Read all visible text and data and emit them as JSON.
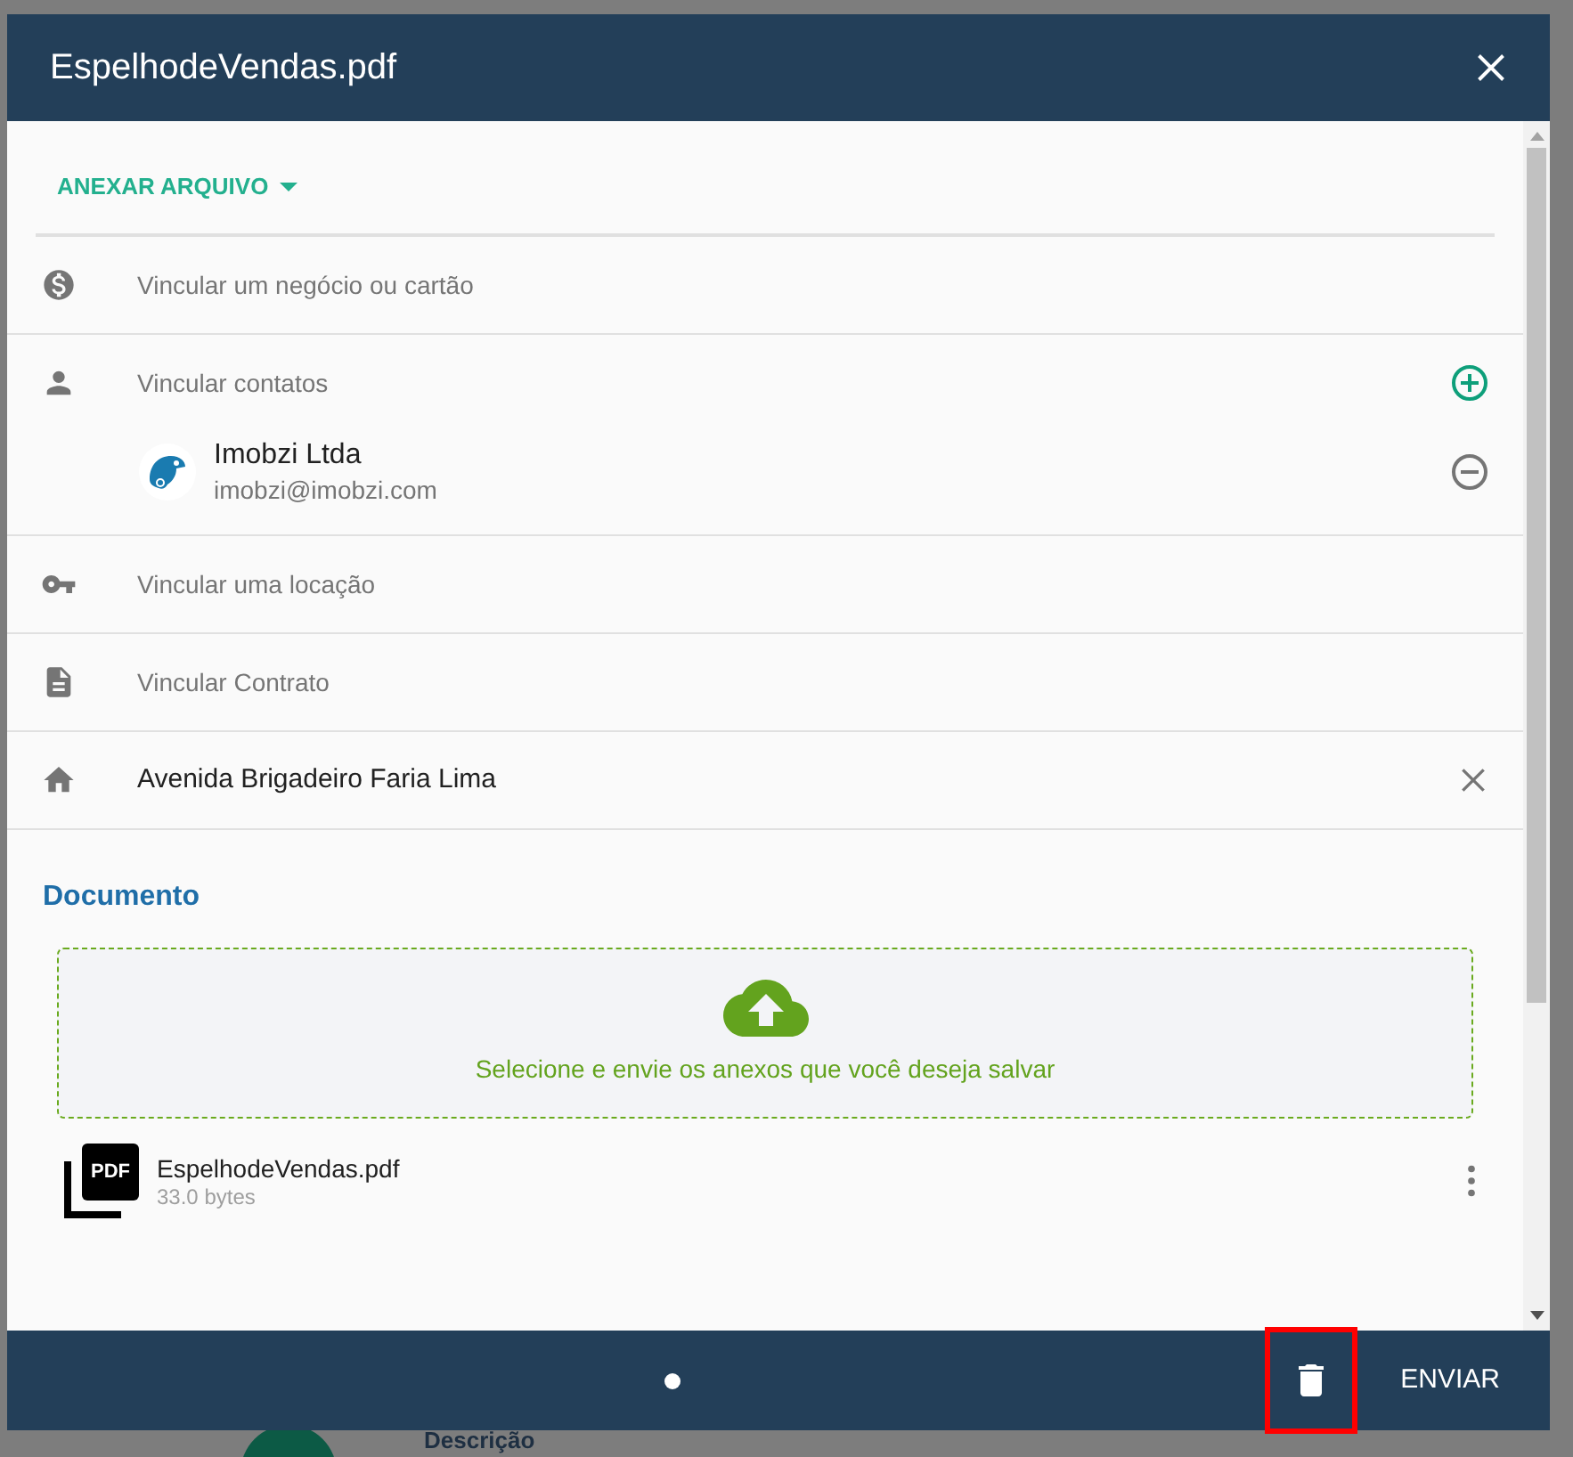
{
  "dialog": {
    "title": "EspelhodeVendas.pdf"
  },
  "attach_menu": {
    "label": "ANEXAR ARQUIVO"
  },
  "rows": [
    {
      "kind": "empty",
      "label": "Vincular um negócio ou cartão"
    },
    {
      "kind": "contacts",
      "label": "Vincular contatos",
      "contacts": [
        {
          "name": "Imobzi Ltda",
          "email": "imobzi@imobzi.com"
        }
      ]
    },
    {
      "kind": "empty",
      "label": "Vincular uma locação"
    },
    {
      "kind": "empty",
      "label": "Vincular Contrato"
    },
    {
      "kind": "filled",
      "label": "Avenida Brigadeiro Faria Lima"
    }
  ],
  "document": {
    "heading": "Documento",
    "dropzone_text": "Selecione e envie os anexos que você deseja salvar",
    "files": [
      {
        "badge": "PDF",
        "name": "EspelhodeVendas.pdf",
        "size": "33.0 bytes"
      }
    ]
  },
  "footer": {
    "send_label": "ENVIAR",
    "delete_highlighted": true
  },
  "background": {
    "label": "Descrição"
  }
}
